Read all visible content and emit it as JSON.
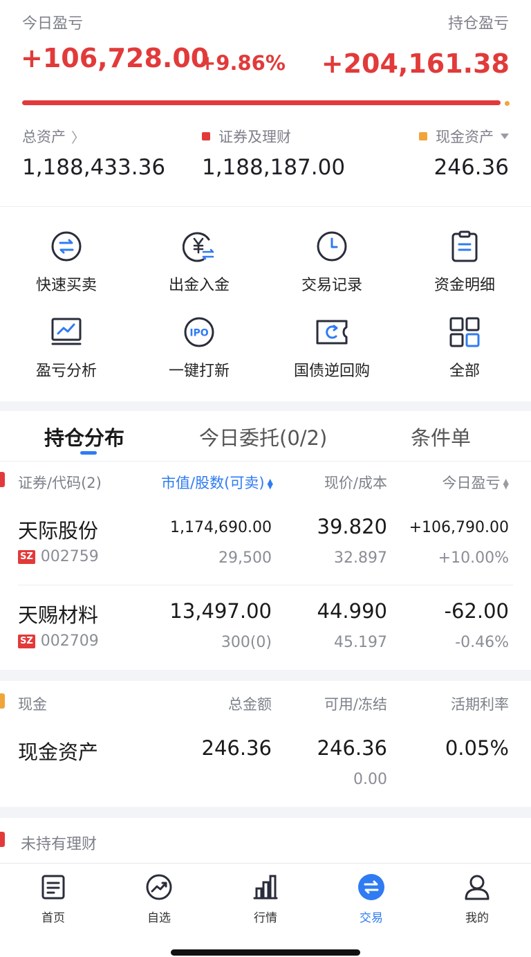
{
  "summary": {
    "today_pnl_label": "今日盈亏",
    "today_pnl_value": "+106,728.00",
    "today_pnl_pct": "+9.86%",
    "holding_pnl_label": "持仓盈亏",
    "holding_pnl_value": "+204,161.38",
    "progress_fraction": 0.9998,
    "total_assets_label": "总资产",
    "total_assets_value": "1,188,433.36",
    "securities_label": "证券及理财",
    "securities_value": "1,188,187.00",
    "cash_label": "现金资产",
    "cash_value": "246.36",
    "colors": {
      "gain": "#e23a3a",
      "loss": "#25a845",
      "accent": "#2f7bf2",
      "cash": "#f0a53a"
    }
  },
  "shortcuts": [
    {
      "label": "快速买卖",
      "icon": "exchange-icon"
    },
    {
      "label": "出金入金",
      "icon": "yuan-transfer-icon"
    },
    {
      "label": "交易记录",
      "icon": "clock-icon"
    },
    {
      "label": "资金明细",
      "icon": "clipboard-icon"
    },
    {
      "label": "盈亏分析",
      "icon": "monitor-chart-icon"
    },
    {
      "label": "一键打新",
      "icon": "ipo-icon"
    },
    {
      "label": "国债逆回购",
      "icon": "ticket-icon"
    },
    {
      "label": "全部",
      "icon": "grid-icon"
    }
  ],
  "tabs": [
    {
      "label": "持仓分布",
      "active": true
    },
    {
      "label": "今日委托(0/2)",
      "active": false
    },
    {
      "label": "条件单",
      "active": false
    }
  ],
  "positions_header": {
    "col1": "证券/代码(2)",
    "col2": "市值/股数(可卖)",
    "col3": "现价/成本",
    "col4": "今日盈亏"
  },
  "positions": [
    {
      "name": "天际股份",
      "market": "SZ",
      "code": "002759",
      "market_value": "1,174,690.00",
      "shares": "29,500",
      "price": "39.820",
      "cost": "32.897",
      "pnl": "+106,790.00",
      "pnl_pct": "+10.00%"
    },
    {
      "name": "天赐材料",
      "market": "SZ",
      "code": "002709",
      "market_value": "13,497.00",
      "shares": "300(0)",
      "price": "44.990",
      "cost": "45.197",
      "pnl": "-62.00",
      "pnl_pct": "-0.46%"
    }
  ],
  "cash_section": {
    "title": "现金",
    "col2": "总金额",
    "col3": "可用/冻结",
    "col4": "活期利率",
    "row_label": "现金资产",
    "total": "246.36",
    "available": "246.36",
    "frozen": "0.00",
    "rate": "0.05%"
  },
  "wealth_section": {
    "title": "未持有理财"
  },
  "bottom_nav": [
    {
      "label": "首页",
      "icon": "home-doc-icon"
    },
    {
      "label": "自选",
      "icon": "trend-icon"
    },
    {
      "label": "行情",
      "icon": "bar-chart-icon"
    },
    {
      "label": "交易",
      "icon": "trade-icon",
      "active": true
    },
    {
      "label": "我的",
      "icon": "user-icon"
    }
  ]
}
